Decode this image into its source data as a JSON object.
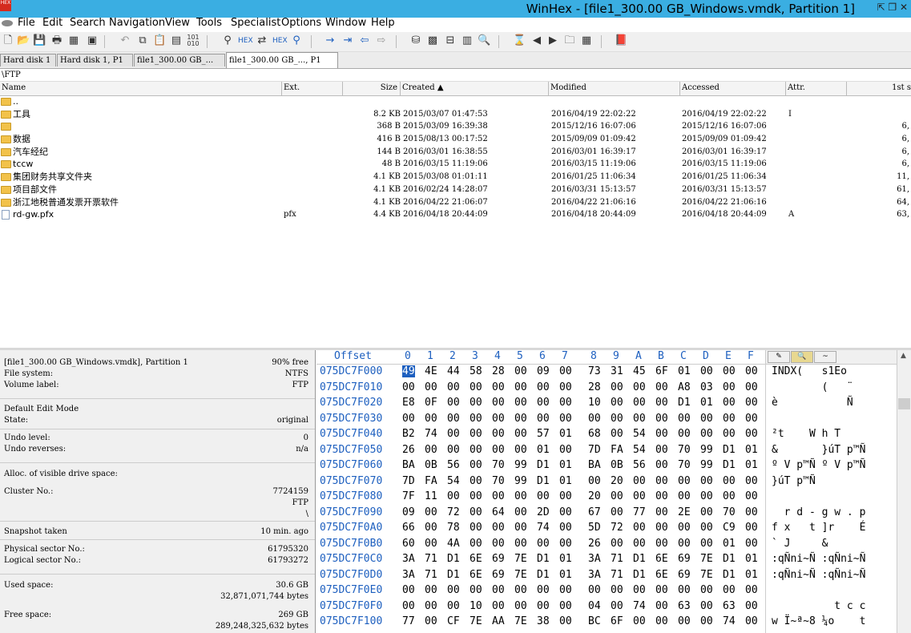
{
  "app": {
    "logo_text": "HEX",
    "title": "WinHex - [file1_300.00 GB_Windows.vmdk, Partition 1]",
    "window_controls": "⇱ ❐ ✕"
  },
  "menu": [
    "File",
    "Edit",
    "Search",
    "Navigation",
    "View",
    "Tools",
    "Specialist",
    "Options",
    "Window",
    "Help"
  ],
  "toolbar": {
    "icons": [
      "new-file-icon",
      "open-file-icon",
      "save-icon",
      "print-icon",
      "properties-icon",
      "open-disk-icon",
      "undo-icon",
      "copy-icon",
      "paste-icon",
      "copy-block-icon",
      "binary-icon",
      "find-text-icon",
      "find-hex-icon",
      "replace-text-icon",
      "replace-hex-icon",
      "find-again-icon",
      "goto-offset-icon",
      "goto-sector-icon",
      "back-icon",
      "forward-icon",
      "disk-editor-icon",
      "ram-editor-icon",
      "disk-tools-icon",
      "calculator-icon",
      "magnify-icon",
      "snapshot-icon",
      "prev-icon",
      "next-icon",
      "folder-icon",
      "table-icon",
      "book-icon"
    ]
  },
  "tabs": [
    {
      "label": "Hard disk 1"
    },
    {
      "label": "Hard disk 1, P1"
    },
    {
      "label": "file1_300.00 GB_..."
    },
    {
      "label": "file1_300.00 GB_..., P1"
    }
  ],
  "path": "\\FTP",
  "directory": {
    "columns": [
      "Name",
      "Ext.",
      "Size",
      "Created ▲",
      "Modified",
      "Accessed",
      "Attr.",
      "1st s"
    ],
    "rows": [
      {
        "name": "..",
        "ext": "",
        "size": "",
        "created": "",
        "modified": "",
        "accessed": "",
        "attr": "",
        "first": "",
        "icon": "folder"
      },
      {
        "name": "工具",
        "ext": "",
        "size": "8.2 KB",
        "created": "2015/03/07  01:47:53",
        "modified": "2016/04/19  22:02:22",
        "accessed": "2016/04/19  22:02:22",
        "attr": "I",
        "first": "",
        "icon": "folder"
      },
      {
        "name": "",
        "ext": "",
        "size": "368 B",
        "created": "2015/03/09  16:39:38",
        "modified": "2015/12/16  16:07:06",
        "accessed": "2015/12/16  16:07:06",
        "attr": "",
        "first": "6,",
        "icon": "folder"
      },
      {
        "name": "数据",
        "ext": "",
        "size": "416 B",
        "created": "2015/08/13  00:17:52",
        "modified": "2015/09/09  01:09:42",
        "accessed": "2015/09/09  01:09:42",
        "attr": "",
        "first": "6,",
        "icon": "folder"
      },
      {
        "name": "汽车经纪",
        "ext": "",
        "size": "144 B",
        "created": "2016/03/01  16:38:55",
        "modified": "2016/03/01  16:39:17",
        "accessed": "2016/03/01  16:39:17",
        "attr": "",
        "first": "6,",
        "icon": "folder"
      },
      {
        "name": "tccw",
        "ext": "",
        "size": "48 B",
        "created": "2016/03/15  11:19:06",
        "modified": "2016/03/15  11:19:06",
        "accessed": "2016/03/15  11:19:06",
        "attr": "",
        "first": "6,",
        "icon": "folder"
      },
      {
        "name": "集团财务共享文件夹",
        "ext": "",
        "size": "4.1 KB",
        "created": "2015/03/08  01:01:11",
        "modified": "2016/01/25  11:06:34",
        "accessed": "2016/01/25  11:06:34",
        "attr": "",
        "first": "11,",
        "icon": "folder"
      },
      {
        "name": "项目部文件",
        "ext": "",
        "size": "4.1 KB",
        "created": "2016/02/24  14:28:07",
        "modified": "2016/03/31  15:13:57",
        "accessed": "2016/03/31  15:13:57",
        "attr": "",
        "first": "61,",
        "icon": "folder"
      },
      {
        "name": "浙江地税普通发票开票软件",
        "ext": "",
        "size": "4.1 KB",
        "created": "2016/04/22  21:06:07",
        "modified": "2016/04/22  21:06:16",
        "accessed": "2016/04/22  21:06:16",
        "attr": "",
        "first": "64,",
        "icon": "folder"
      },
      {
        "name": "rd-gw.pfx",
        "ext": "pfx",
        "size": "4.4 KB",
        "created": "2016/04/18  20:44:09",
        "modified": "2016/04/18  20:44:09",
        "accessed": "2016/04/18  20:44:09",
        "attr": "A",
        "first": "63,",
        "icon": "file"
      }
    ]
  },
  "info": {
    "file": "[file1_300.00 GB_Windows.vmdk], Partition 1",
    "free_pct": "90% free",
    "filesystem_label": "File system:",
    "filesystem": "NTFS",
    "volume_label_label": "Volume label:",
    "volume_label": "FTP",
    "edit_mode_label": "Default Edit Mode",
    "state_label": "State:",
    "state": "original",
    "undo_level_label": "Undo level:",
    "undo_level": "0",
    "undo_reverses_label": "Undo reverses:",
    "undo_reverses": "n/a",
    "alloc_label": "Alloc. of visible drive space:",
    "cluster_label": "Cluster No.:",
    "cluster": "7724159",
    "cluster_dir": "FTP",
    "cluster_path": "\\",
    "snapshot_label": "Snapshot taken",
    "snapshot": "10 min. ago",
    "phys_label": "Physical sector No.:",
    "phys": "61795320",
    "logical_label": "Logical sector No.:",
    "logical": "61793272",
    "used_label": "Used space:",
    "used": "30.6 GB",
    "used_bytes": "32,871,071,744 bytes",
    "free_label": "Free space:",
    "free": "269 GB",
    "free_bytes": "289,248,325,632 bytes"
  },
  "hex": {
    "offset_header": "Offset",
    "columns": [
      "0",
      "1",
      "2",
      "3",
      "4",
      "5",
      "6",
      "7",
      "8",
      "9",
      "A",
      "B",
      "C",
      "D",
      "E",
      "F"
    ],
    "rows": [
      {
        "offset": "075DC7F000",
        "bytes": [
          "49",
          "4E",
          "44",
          "58",
          "28",
          "00",
          "09",
          "00",
          "73",
          "31",
          "45",
          "6F",
          "01",
          "00",
          "00",
          "00"
        ],
        "text": "INDX(   s1Eo    "
      },
      {
        "offset": "075DC7F010",
        "bytes": [
          "00",
          "00",
          "00",
          "00",
          "00",
          "00",
          "00",
          "00",
          "28",
          "00",
          "00",
          "00",
          "A8",
          "03",
          "00",
          "00"
        ],
        "text": "        (   ¨   "
      },
      {
        "offset": "075DC7F020",
        "bytes": [
          "E8",
          "0F",
          "00",
          "00",
          "00",
          "00",
          "00",
          "00",
          "10",
          "00",
          "00",
          "00",
          "D1",
          "01",
          "00",
          "00"
        ],
        "text": "è           Ñ   "
      },
      {
        "offset": "075DC7F030",
        "bytes": [
          "00",
          "00",
          "00",
          "00",
          "00",
          "00",
          "00",
          "00",
          "00",
          "00",
          "00",
          "00",
          "00",
          "00",
          "00",
          "00"
        ],
        "text": ""
      },
      {
        "offset": "075DC7F040",
        "bytes": [
          "B2",
          "74",
          "00",
          "00",
          "00",
          "00",
          "57",
          "01",
          "68",
          "00",
          "54",
          "00",
          "00",
          "00",
          "00",
          "00"
        ],
        "text": "²t    W h T     "
      },
      {
        "offset": "075DC7F050",
        "bytes": [
          "26",
          "00",
          "00",
          "00",
          "00",
          "00",
          "01",
          "00",
          "7D",
          "FA",
          "54",
          "00",
          "70",
          "99",
          "D1",
          "01"
        ],
        "text": "&       }úT p™Ñ "
      },
      {
        "offset": "075DC7F060",
        "bytes": [
          "BA",
          "0B",
          "56",
          "00",
          "70",
          "99",
          "D1",
          "01",
          "BA",
          "0B",
          "56",
          "00",
          "70",
          "99",
          "D1",
          "01"
        ],
        "text": "º V p™Ñ º V p™Ñ "
      },
      {
        "offset": "075DC7F070",
        "bytes": [
          "7D",
          "FA",
          "54",
          "00",
          "70",
          "99",
          "D1",
          "01",
          "00",
          "20",
          "00",
          "00",
          "00",
          "00",
          "00",
          "00"
        ],
        "text": "}úT p™Ñ         "
      },
      {
        "offset": "075DC7F080",
        "bytes": [
          "7F",
          "11",
          "00",
          "00",
          "00",
          "00",
          "00",
          "00",
          "20",
          "00",
          "00",
          "00",
          "00",
          "00",
          "00",
          "00"
        ],
        "text": ""
      },
      {
        "offset": "075DC7F090",
        "bytes": [
          "09",
          "00",
          "72",
          "00",
          "64",
          "00",
          "2D",
          "00",
          "67",
          "00",
          "77",
          "00",
          "2E",
          "00",
          "70",
          "00"
        ],
        "text": "  r d - g w . p "
      },
      {
        "offset": "075DC7F0A0",
        "bytes": [
          "66",
          "00",
          "78",
          "00",
          "00",
          "00",
          "74",
          "00",
          "5D",
          "72",
          "00",
          "00",
          "00",
          "00",
          "C9",
          "00"
        ],
        "text": "f x   t ]r    É "
      },
      {
        "offset": "075DC7F0B0",
        "bytes": [
          "60",
          "00",
          "4A",
          "00",
          "00",
          "00",
          "00",
          "00",
          "26",
          "00",
          "00",
          "00",
          "00",
          "00",
          "01",
          "00"
        ],
        "text": "` J     &       "
      },
      {
        "offset": "075DC7F0C0",
        "bytes": [
          "3A",
          "71",
          "D1",
          "6E",
          "69",
          "7E",
          "D1",
          "01",
          "3A",
          "71",
          "D1",
          "6E",
          "69",
          "7E",
          "D1",
          "01"
        ],
        "text": ":qÑni~Ñ :qÑni~Ñ "
      },
      {
        "offset": "075DC7F0D0",
        "bytes": [
          "3A",
          "71",
          "D1",
          "6E",
          "69",
          "7E",
          "D1",
          "01",
          "3A",
          "71",
          "D1",
          "6E",
          "69",
          "7E",
          "D1",
          "01"
        ],
        "text": ":qÑni~Ñ :qÑni~Ñ "
      },
      {
        "offset": "075DC7F0E0",
        "bytes": [
          "00",
          "00",
          "00",
          "00",
          "00",
          "00",
          "00",
          "00",
          "00",
          "00",
          "00",
          "00",
          "00",
          "00",
          "00",
          "00"
        ],
        "text": ""
      },
      {
        "offset": "075DC7F0F0",
        "bytes": [
          "00",
          "00",
          "00",
          "10",
          "00",
          "00",
          "00",
          "00",
          "04",
          "00",
          "74",
          "00",
          "63",
          "00",
          "63",
          "00"
        ],
        "text": "          t c c "
      },
      {
        "offset": "075DC7F100",
        "bytes": [
          "77",
          "00",
          "CF",
          "7E",
          "AA",
          "7E",
          "38",
          "00",
          "BC",
          "6F",
          "00",
          "00",
          "00",
          "00",
          "74",
          "00"
        ],
        "text": "w Ï~ª~8 ¼o    t "
      }
    ]
  },
  "colors": {
    "titlebar": "#3aaee2",
    "offset_blue": "#1d5fbf",
    "folder": "#f2c24a"
  }
}
